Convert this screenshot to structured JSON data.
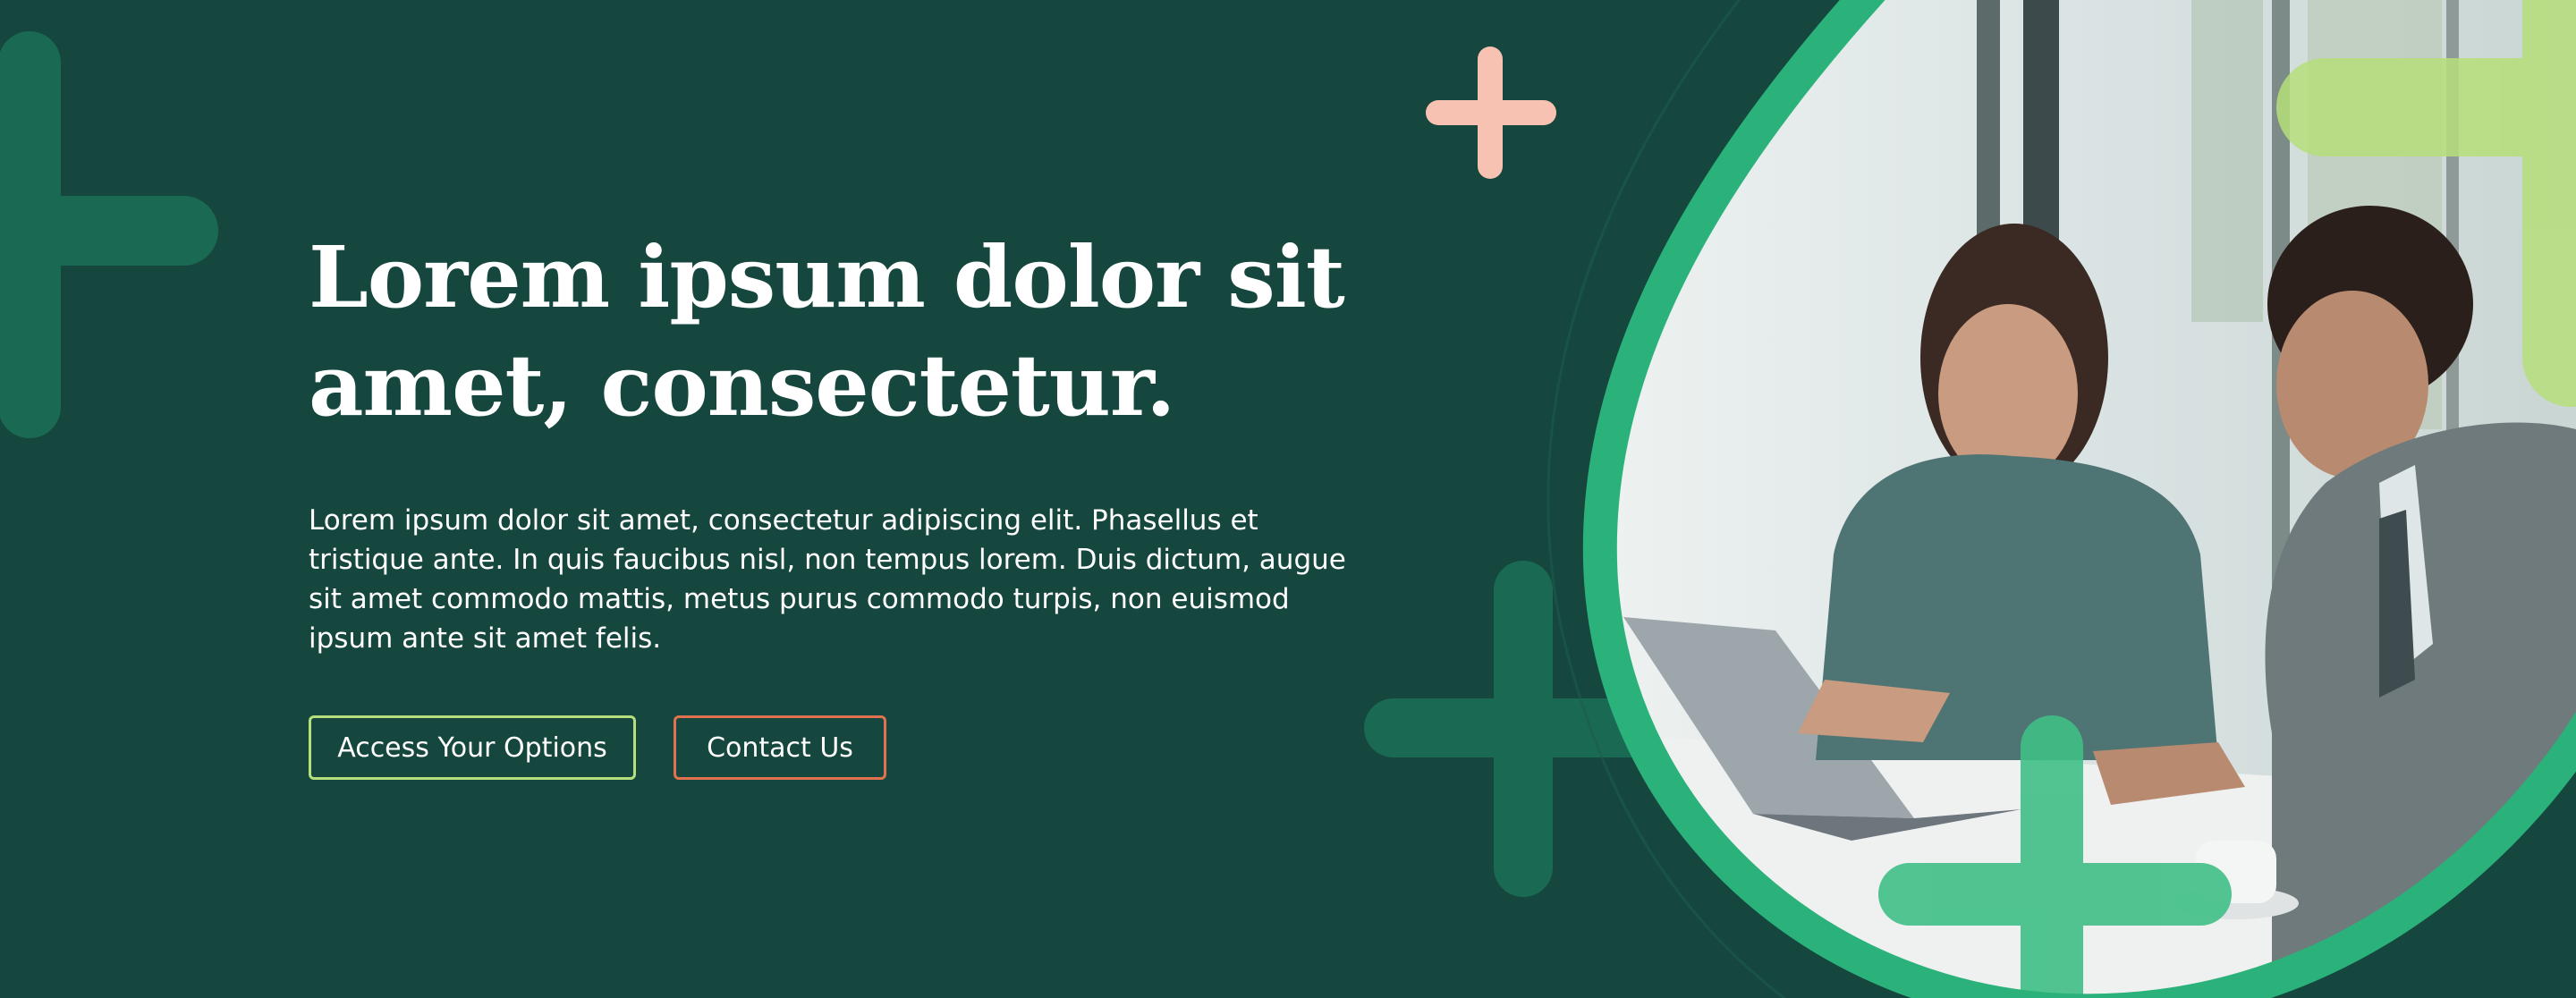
{
  "hero": {
    "headline_line1": "Lorem ipsum dolor sit",
    "headline_line2": "amet, consectetur.",
    "body": "Lorem ipsum dolor sit amet, consectetur adipiscing elit. Phasellus et tristique ante. In quis faucibus nisl, non tempus lorem. Duis dictum, augue sit amet commodo mattis, metus purus commodo turpis, non euismod ipsum ante sit amet felis.",
    "primary_button": "Access Your Options",
    "secondary_button": "Contact Us"
  },
  "colors": {
    "background": "#15473f",
    "plus_dark": "#1a6a53",
    "plus_pink": "#f7c2b2",
    "plus_lime": "#b6de7a",
    "frame_green": "#2bb27a",
    "button_primary_border": "#b6de7a",
    "button_secondary_border": "#e0724f"
  },
  "decorations": {
    "icons": [
      "plus-icon",
      "plus-icon",
      "plus-icon",
      "plus-icon",
      "plus-icon"
    ]
  }
}
